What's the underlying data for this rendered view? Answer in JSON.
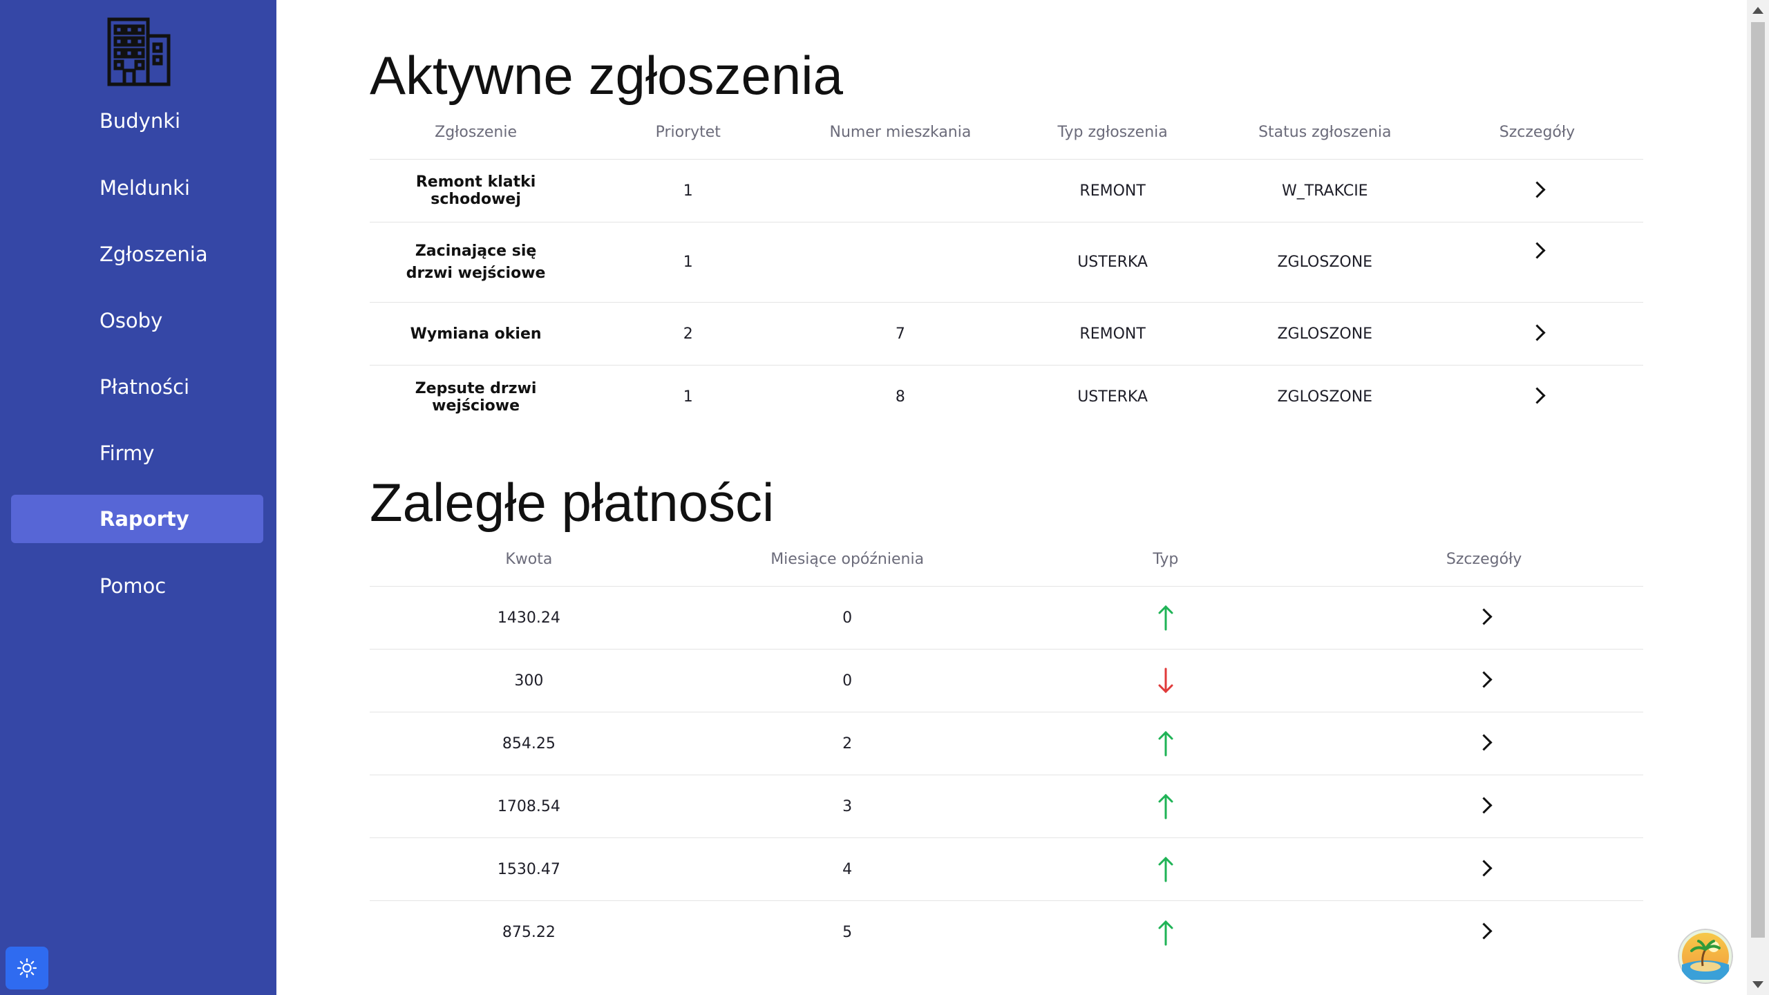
{
  "sidebar": {
    "logo_icon": "building-icon",
    "items": [
      {
        "label": "Budynki",
        "active": false
      },
      {
        "label": "Meldunki",
        "active": false
      },
      {
        "label": "Zgłoszenia",
        "active": false
      },
      {
        "label": "Osoby",
        "active": false
      },
      {
        "label": "Płatności",
        "active": false
      },
      {
        "label": "Firmy",
        "active": false
      },
      {
        "label": "Raporty",
        "active": true
      },
      {
        "label": "Pomoc",
        "active": false
      }
    ],
    "theme_toggle_icon": "sun-icon"
  },
  "colors": {
    "sidebar_bg": "#3547a6",
    "active_item_bg": "#5766d6",
    "up_arrow": "#1fb356",
    "down_arrow": "#e03a3a",
    "theme_toggle_bg": "#2f6bf0"
  },
  "requests": {
    "title": "Aktywne zgłoszenia",
    "columns": [
      "Zgłoszenie",
      "Priorytet",
      "Numer mieszkania",
      "Typ zgłoszenia",
      "Status zgłoszenia",
      "Szczegóły"
    ],
    "rows": [
      {
        "name": "Remont klatki schodowej",
        "priority": "1",
        "apartment": "",
        "type": "REMONT",
        "status": "W_TRAKCIE"
      },
      {
        "name": "Zacinające się drzwi wejściowe",
        "priority": "1",
        "apartment": "",
        "type": "USTERKA",
        "status": "ZGLOSZONE"
      },
      {
        "name": "Wymiana okien",
        "priority": "2",
        "apartment": "7",
        "type": "REMONT",
        "status": "ZGLOSZONE"
      },
      {
        "name": "Zepsute drzwi wejściowe",
        "priority": "1",
        "apartment": "8",
        "type": "USTERKA",
        "status": "ZGLOSZONE"
      }
    ]
  },
  "payments": {
    "title": "Zaległe płatności",
    "columns": [
      "Kwota",
      "Miesiące opóźnienia",
      "Typ",
      "Szczegóły"
    ],
    "rows": [
      {
        "amount": "1430.24",
        "months": "0",
        "type_icon": "arrow-up-icon"
      },
      {
        "amount": "300",
        "months": "0",
        "type_icon": "arrow-down-icon"
      },
      {
        "amount": "854.25",
        "months": "2",
        "type_icon": "arrow-up-icon"
      },
      {
        "amount": "1708.54",
        "months": "3",
        "type_icon": "arrow-up-icon"
      },
      {
        "amount": "1530.47",
        "months": "4",
        "type_icon": "arrow-up-icon"
      },
      {
        "amount": "875.22",
        "months": "5",
        "type_icon": "arrow-up-icon"
      }
    ]
  }
}
